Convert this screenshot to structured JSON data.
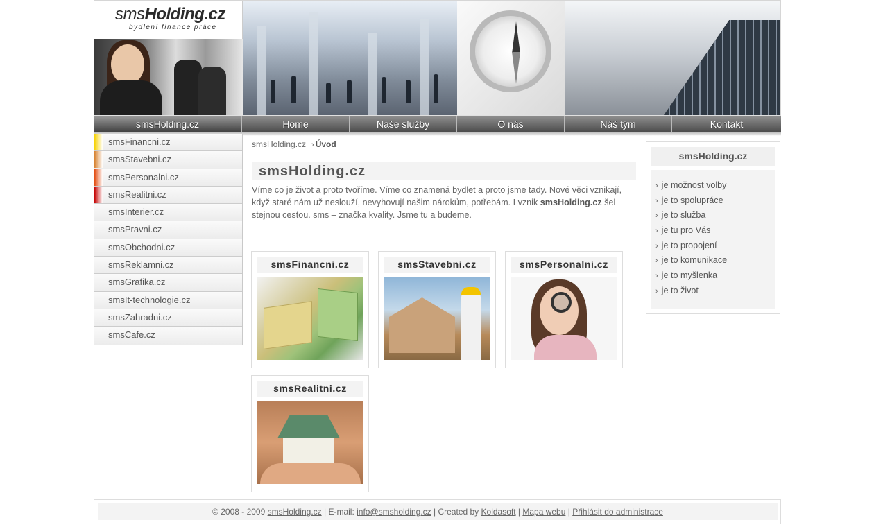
{
  "header": {
    "logo_bold": "Holding.cz",
    "logo_light": "sms",
    "slogan": "bydlení finance práce"
  },
  "nav": {
    "brand": "smsHolding.cz",
    "items": [
      "Home",
      "Naše služby",
      "O nás",
      "Náš tým",
      "Kontakt"
    ]
  },
  "left_menu": {
    "items": [
      {
        "label": "smsFinancni.cz",
        "color": "#f6d100"
      },
      {
        "label": "smsStavebni.cz",
        "color": "#d7812e"
      },
      {
        "label": "smsPersonalni.cz",
        "color": "#e24a0f"
      },
      {
        "label": "smsRealitni.cz",
        "color": "#c40000"
      },
      {
        "label": "smsInterier.cz",
        "color": ""
      },
      {
        "label": "smsPravni.cz",
        "color": ""
      },
      {
        "label": "smsObchodni.cz",
        "color": ""
      },
      {
        "label": "smsReklamni.cz",
        "color": ""
      },
      {
        "label": "smsGrafika.cz",
        "color": ""
      },
      {
        "label": "smsIt-technologie.cz",
        "color": ""
      },
      {
        "label": "smsZahradni.cz",
        "color": ""
      },
      {
        "label": "smsCafe.cz",
        "color": ""
      }
    ]
  },
  "breadcrumb": {
    "link": "smsHolding.cz",
    "separator": "›",
    "current": "Úvod"
  },
  "main": {
    "title": "smsHolding.cz",
    "text_before": "Víme co je život a proto tvoříme. Víme co znamená bydlet a proto jsme tady. Nové věci vznikají, když staré nám už neslouží, nevyhovují našim nárokům, potřebám. I vznik ",
    "text_bold": "smsHolding.cz",
    "text_after": " šel stejnou cestou. sms – značka kvality. Jsme tu a budeme.",
    "cards": [
      {
        "title": "smsFinancni.cz"
      },
      {
        "title": "smsStavebni.cz"
      },
      {
        "title": "smsPersonalni.cz"
      },
      {
        "title": "smsRealitni.cz"
      }
    ]
  },
  "sidebar": {
    "title": "smsHolding.cz",
    "items": [
      "je možnost volby",
      "je to spolupráce",
      "je to služba",
      "je tu pro Vás",
      "je to propojení",
      "je to komunikace",
      "je to myšlenka",
      "je to život"
    ]
  },
  "footer": {
    "copyright": "© 2008 - 2009 ",
    "site_link": "smsHolding.cz",
    "email_label": " | E-mail: ",
    "email": "info@smsholding.cz",
    "created_label": " | Created by ",
    "creator": "Koldasoft",
    "sep": " | ",
    "sitemap": "Mapa webu",
    "admin": "Přihlásit do administrace"
  }
}
